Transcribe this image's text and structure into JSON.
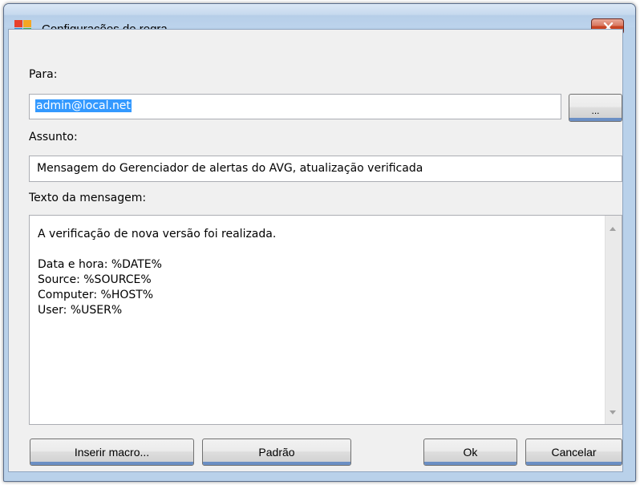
{
  "window": {
    "title": "Configurações de regra",
    "icon": "avg-logo-icon",
    "close_icon": "close-icon"
  },
  "to": {
    "label": "Para:",
    "value": "admin@local.net",
    "browse_label": "..."
  },
  "subject": {
    "label": "Assunto:",
    "value": "Mensagem do Gerenciador de alertas do AVG, atualização verificada"
  },
  "message": {
    "label": "Texto da mensagem:",
    "lines": [
      "A verificação de nova versão foi realizada.",
      "",
      "Data e hora: %DATE%",
      "Source: %SOURCE%",
      "Computer: %HOST%",
      "User: %USER%"
    ]
  },
  "buttons": {
    "insert_macro": "Inserir macro...",
    "default": "Padrão",
    "ok": "Ok",
    "cancel": "Cancelar"
  },
  "colors": {
    "selection": "#3399ff",
    "close_button": "#c6401f",
    "frame": "#b9d1ea"
  }
}
